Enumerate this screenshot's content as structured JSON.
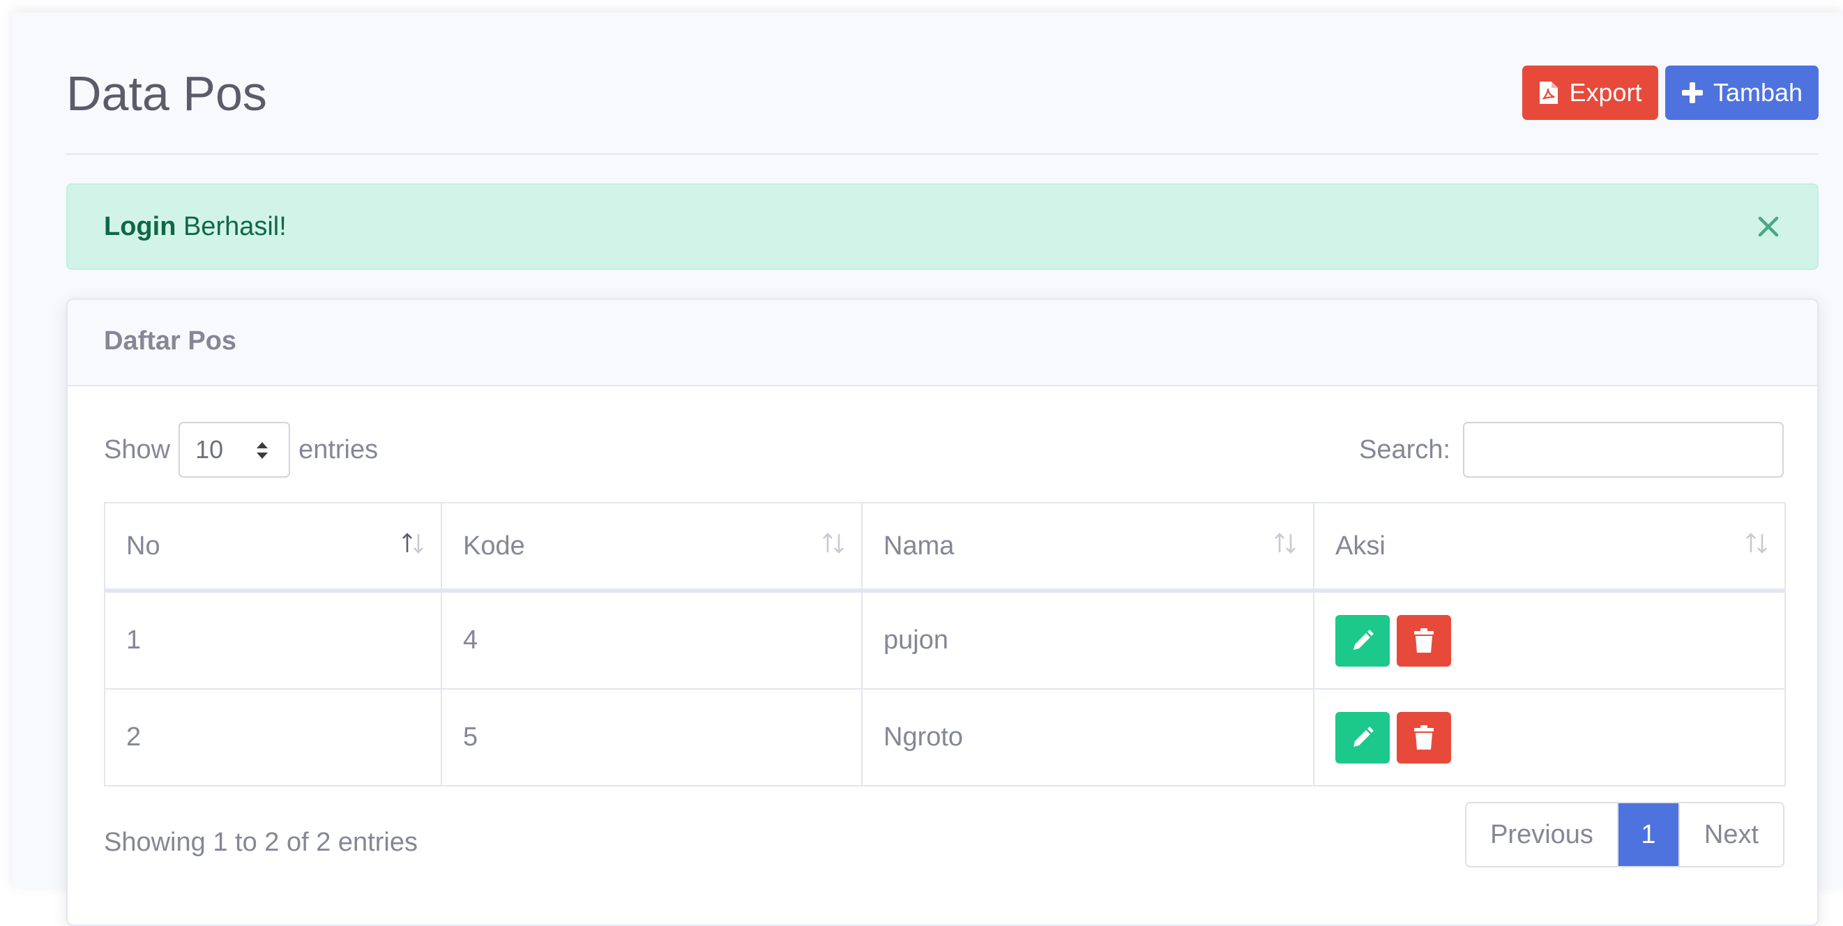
{
  "header": {
    "title": "Data Pos",
    "export_label": "Export",
    "add_label": "Tambah"
  },
  "alert": {
    "bold": "Login",
    "message": " Berhasil!"
  },
  "card": {
    "title": "Daftar Pos"
  },
  "length": {
    "show_label": "Show",
    "selected": "10",
    "entries_label": "entries"
  },
  "search": {
    "label": "Search:",
    "value": ""
  },
  "table": {
    "columns": [
      "No",
      "Kode",
      "Nama",
      "Aksi"
    ],
    "rows": [
      {
        "no": "1",
        "kode": "4",
        "nama": "pujon"
      },
      {
        "no": "2",
        "kode": "5",
        "nama": "Ngroto"
      }
    ]
  },
  "footer": {
    "info": "Showing 1 to 2 of 2 entries"
  },
  "pagination": {
    "previous": "Previous",
    "current": "1",
    "next": "Next"
  },
  "colors": {
    "primary": "#4e73df",
    "danger": "#e74a3b",
    "success": "#1cc88a",
    "alert_bg": "#d2f4e8"
  }
}
